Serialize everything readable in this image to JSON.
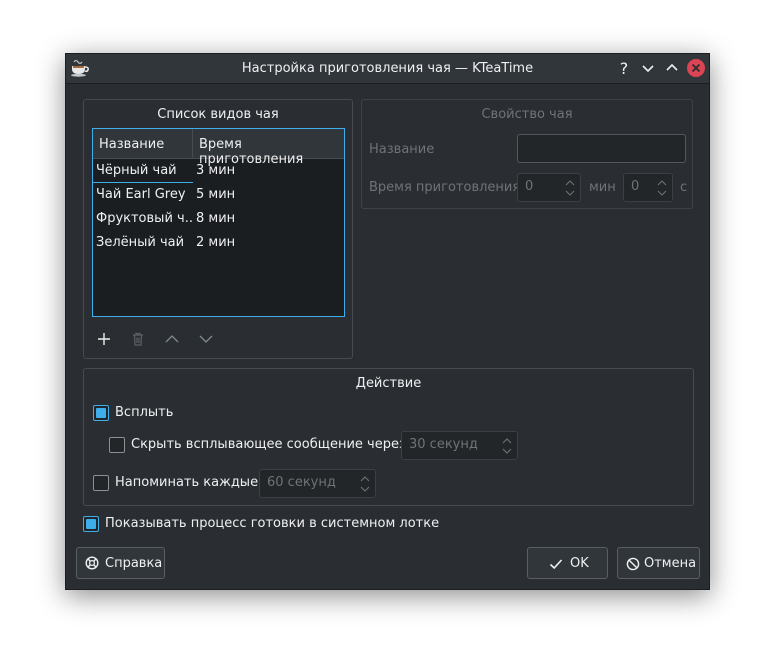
{
  "window": {
    "title": "Настройка приготовления чая — KTeaTime",
    "buttons": [
      "help-icon",
      "minimize-icon",
      "maximize-icon",
      "close-icon"
    ]
  },
  "tea_list": {
    "title": "Список видов чая",
    "columns": [
      "Название",
      "Время приготовления"
    ],
    "rows": [
      {
        "name": "Чёрный чай",
        "time": "3 мин"
      },
      {
        "name": "Чай Earl Grey",
        "time": "5 мин"
      },
      {
        "name": "Фруктовый ч...",
        "time": "8 мин"
      },
      {
        "name": "Зелёный чай",
        "time": "2 мин"
      }
    ],
    "toolbar": [
      "plus-icon",
      "trash-icon",
      "chevron-up-icon",
      "chevron-down-icon"
    ]
  },
  "tea_properties": {
    "title": "Свойство чая",
    "name_label": "Название",
    "name_value": "",
    "time_label": "Время приготовления",
    "minutes_value": "0",
    "minutes_unit": "мин",
    "seconds_value": "0",
    "seconds_unit": "с"
  },
  "action": {
    "title": "Действие",
    "popup_label": "Всплыть",
    "popup_checked": true,
    "hide_popup_label": "Скрыть всплывающее сообщение через",
    "hide_popup_checked": false,
    "hide_popup_value": "30 секунд",
    "remind_label": "Напоминать каждые",
    "remind_checked": false,
    "remind_value": "60 секунд"
  },
  "tray_progress": {
    "label": "Показывать процесс готовки в системном лотке",
    "checked": true
  },
  "footer": {
    "help_label": "Справка",
    "ok_label": "OK",
    "cancel_label": "Отмена"
  },
  "colors": {
    "accent": "#3daee9",
    "window_bg": "#2a2e32",
    "close_button": "#da4453"
  }
}
